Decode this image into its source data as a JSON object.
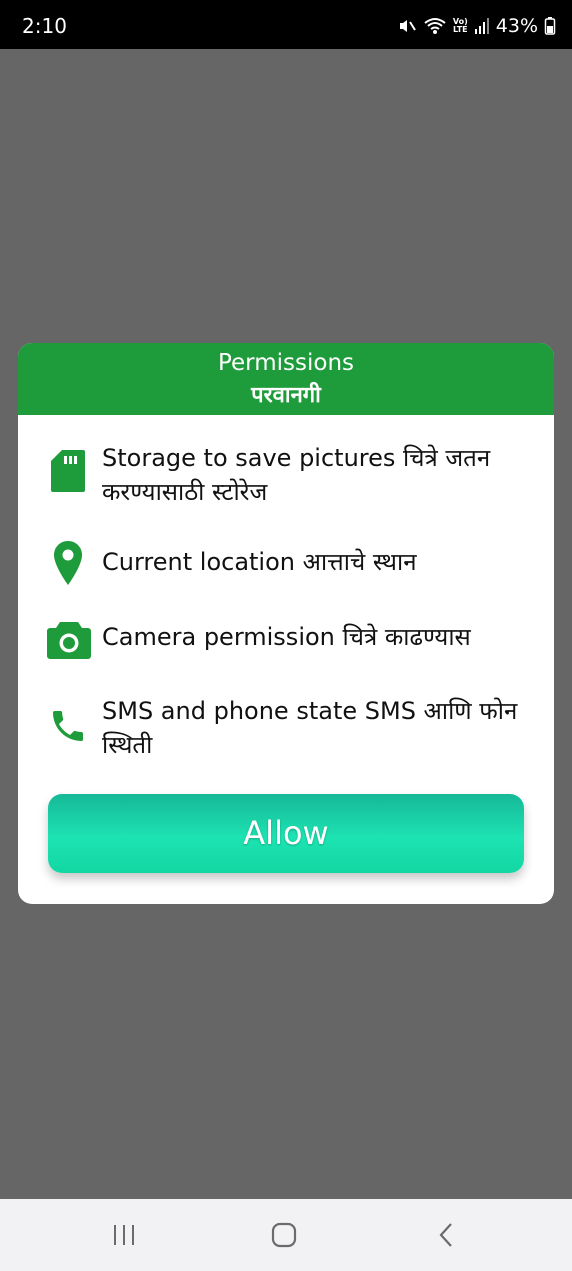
{
  "status_bar": {
    "time": "2:10",
    "volte_label": "Vo)",
    "lte_label": "LTE",
    "battery": "43%"
  },
  "dialog": {
    "title": "Permissions",
    "subtitle": "परवानगी",
    "header_color": "#1e9b3a",
    "icon_color": "#1e9b3a",
    "items": [
      {
        "icon": "sd-card-icon",
        "label": "Storage to save pictures चित्रे जतन करण्यासाठी स्टोरेज"
      },
      {
        "icon": "location-pin-icon",
        "label": "Current location  आत्ताचे स्थान"
      },
      {
        "icon": "camera-icon",
        "label": "Camera permission चित्रे काढण्यास"
      },
      {
        "icon": "phone-icon",
        "label": "SMS and phone state SMS आणि फोन स्थिती"
      }
    ],
    "allow_label": "Allow",
    "allow_color": "#1de3b2"
  },
  "nav_bar": {
    "recents_icon": "recents-icon",
    "home_icon": "home-icon",
    "back_icon": "back-icon"
  }
}
